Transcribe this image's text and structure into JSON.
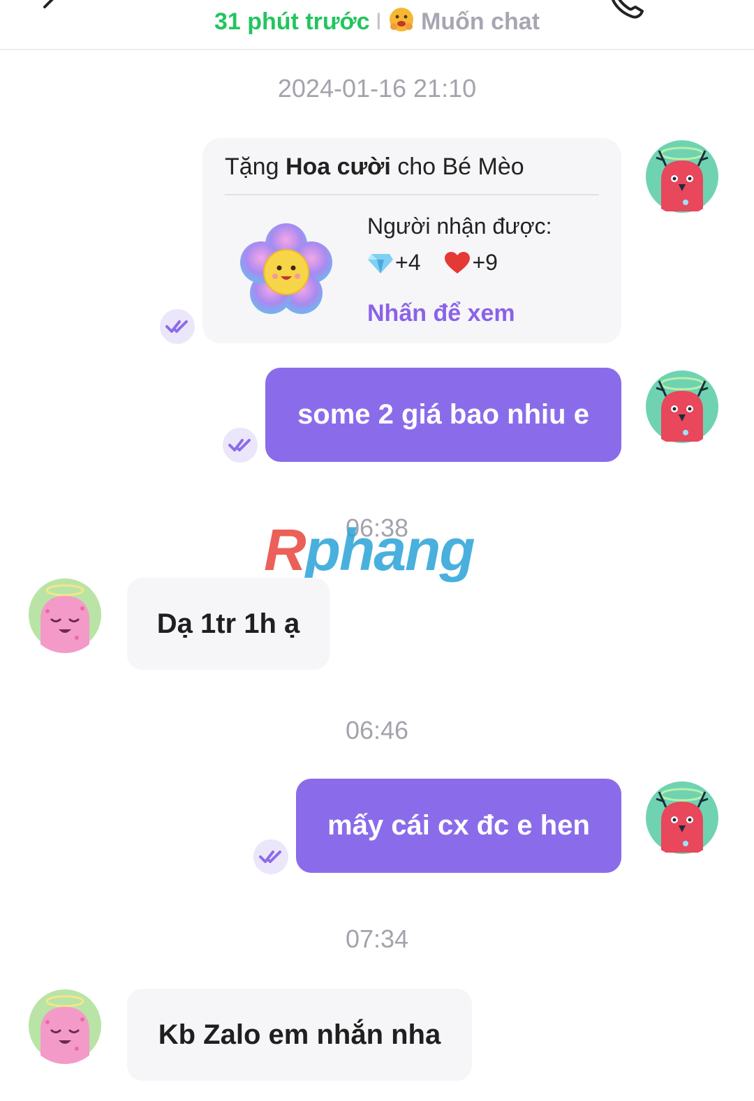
{
  "header": {
    "online_status": "31 phút trước",
    "separator": "I",
    "mood": "Muốn chat"
  },
  "messages": {
    "ts1": "2024-01-16 21:10",
    "gift": {
      "prefix": "Tặng ",
      "item": "Hoa cười",
      "suffix": " cho Bé Mèo",
      "recipient_label": "Người nhận được:",
      "diamonds": "+4",
      "hearts": "+9",
      "link": "Nhấn để xem"
    },
    "msg1": "some 2 giá bao nhiu e",
    "ts2": "06:38",
    "msg2": "Dạ 1tr 1h ạ",
    "ts3": "06:46",
    "msg3": "mấy cái cx đc e hen",
    "ts4": "07:34",
    "msg4": "Kb Zalo em nhắn nha"
  },
  "watermark": {
    "part1": "R",
    "part2": "phang"
  },
  "colors": {
    "accent": "#8a6cea",
    "online": "#22c55e",
    "incoming_bubble": "#f6f6f8",
    "link": "#8b62e8"
  },
  "icons": [
    "back-arrow-icon",
    "phone-icon",
    "mood-emoji-icon",
    "flower-gift-icon",
    "diamond-icon",
    "heart-icon",
    "read-receipt-icon"
  ]
}
